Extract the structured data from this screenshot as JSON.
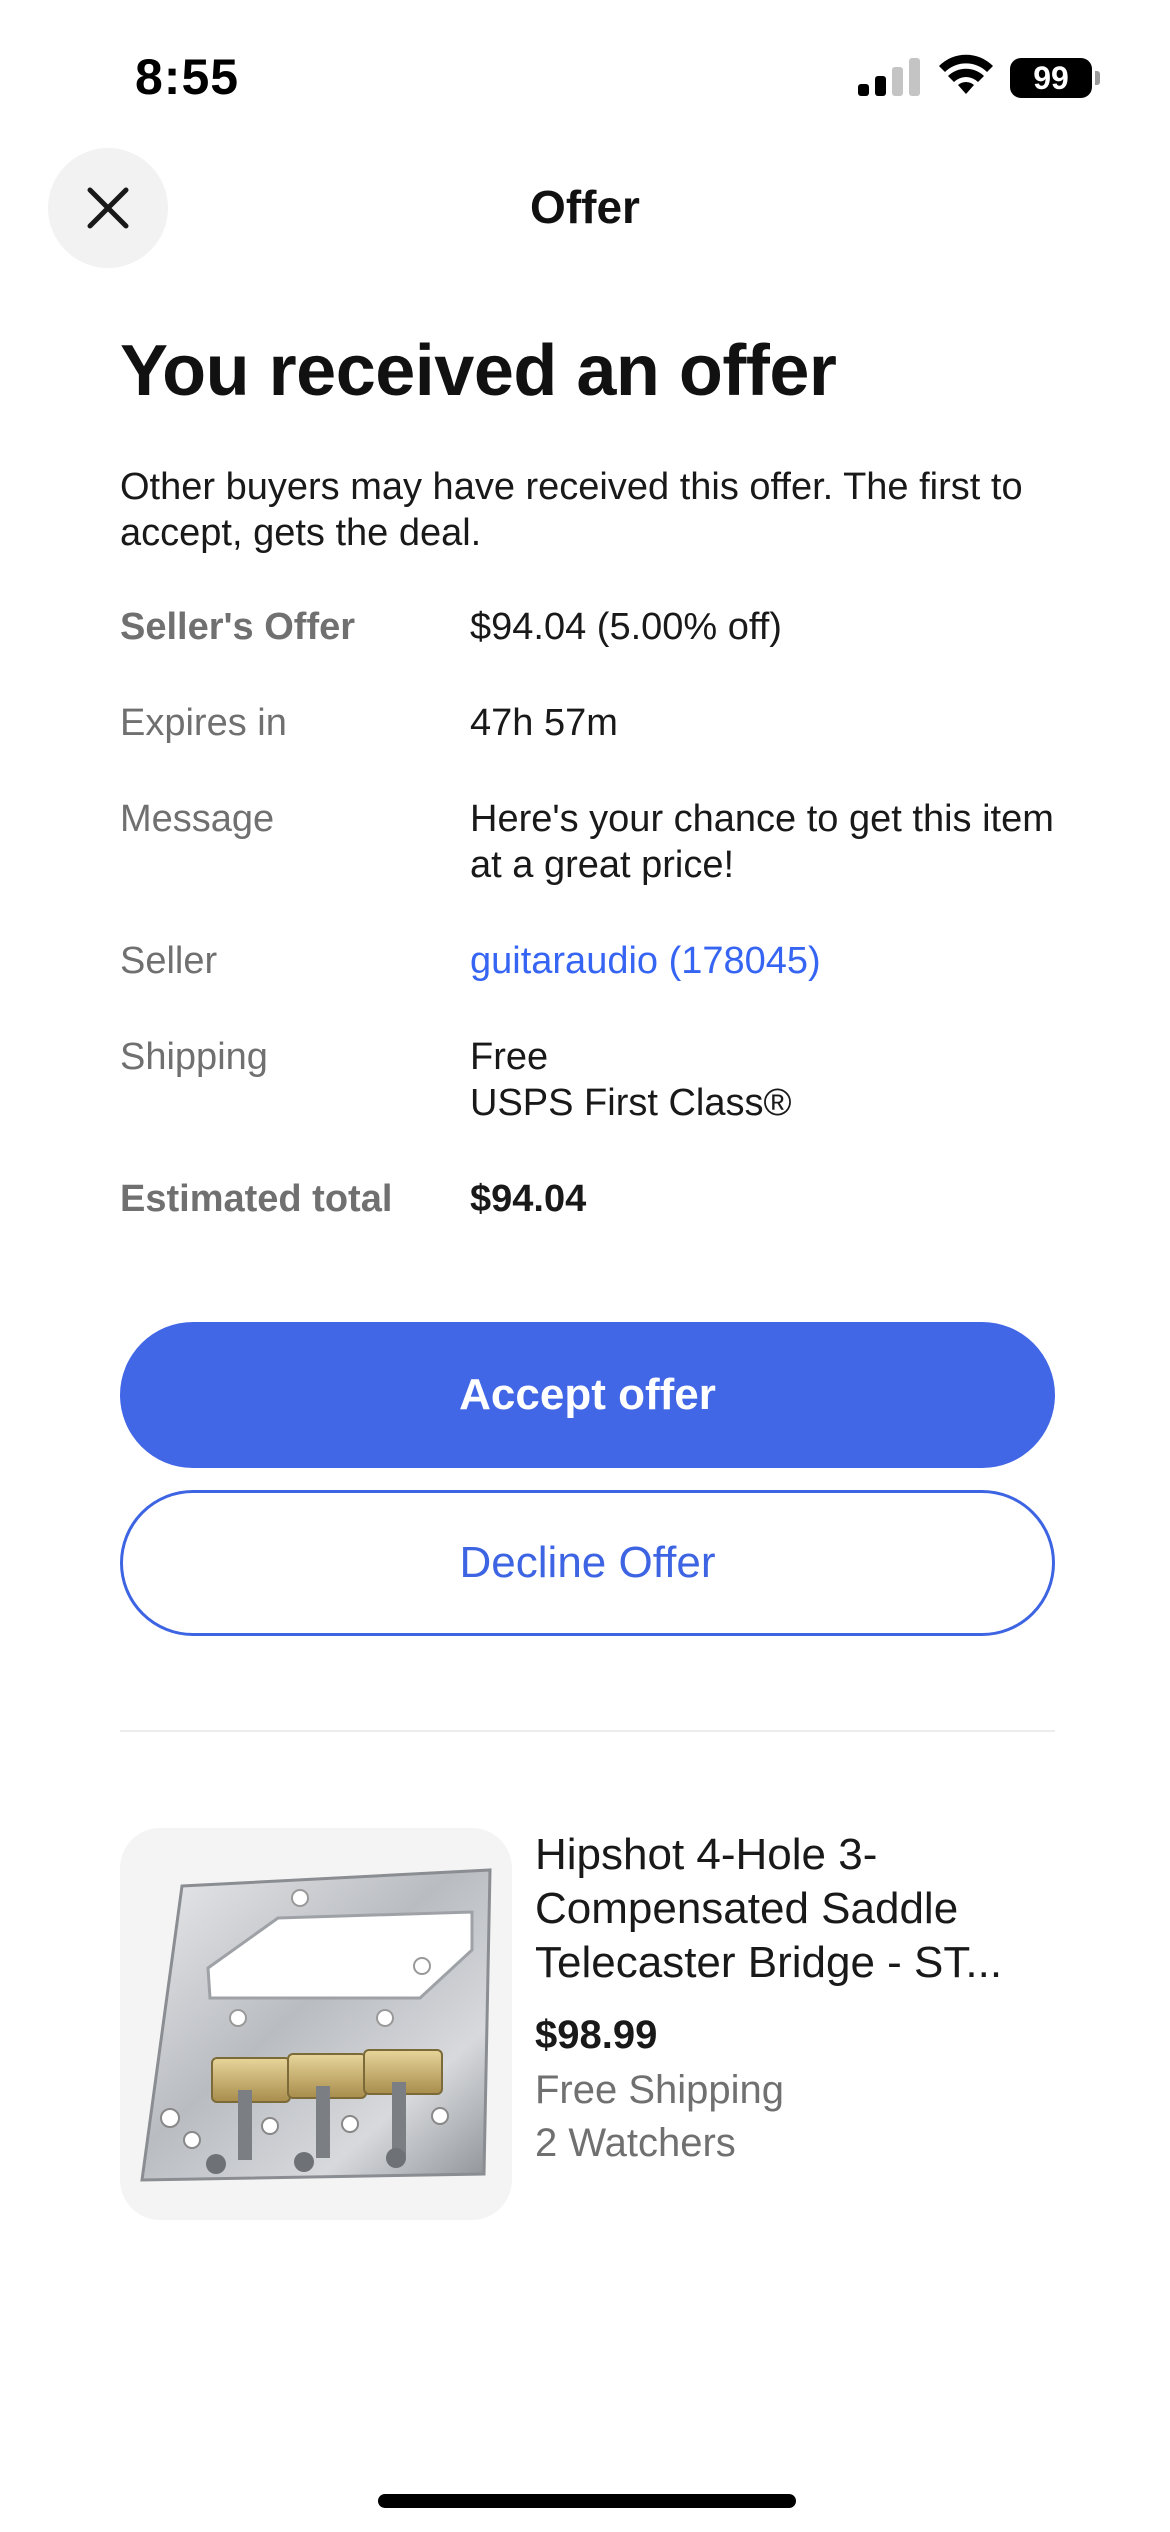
{
  "status_bar": {
    "time": "8:55",
    "battery": "99",
    "icons": [
      "signal-icon",
      "wifi-icon",
      "battery-icon"
    ]
  },
  "header": {
    "title": "Offer",
    "close_icon": "close-icon"
  },
  "offer": {
    "title": "You received an offer",
    "intro": "Other buyers may have received this offer. The first to accept, gets the deal.",
    "rows": [
      {
        "label": "Seller's Offer",
        "value": "$94.04 (5.00% off)"
      },
      {
        "label": "Expires in",
        "value": "47h 57m"
      },
      {
        "label": "Message",
        "value": "Here's your chance to get this item at a great price!"
      },
      {
        "label": "Seller",
        "value": "guitaraudio (178045)"
      },
      {
        "label": "Shipping",
        "value": "Free",
        "value_line2": "USPS First Class®"
      },
      {
        "label": "Estimated total",
        "value": "$94.04"
      }
    ]
  },
  "actions": {
    "accept_label": "Accept offer",
    "decline_label": "Decline Offer"
  },
  "item": {
    "title": "Hipshot 4-Hole 3-Compensated Saddle Telecaster Bridge - ST...",
    "price": "$98.99",
    "shipping": "Free Shipping",
    "watchers": "2 Watchers"
  },
  "colors": {
    "accent": "#3665f3",
    "accept_button": "#4267e6",
    "secondary_text": "#707070"
  }
}
